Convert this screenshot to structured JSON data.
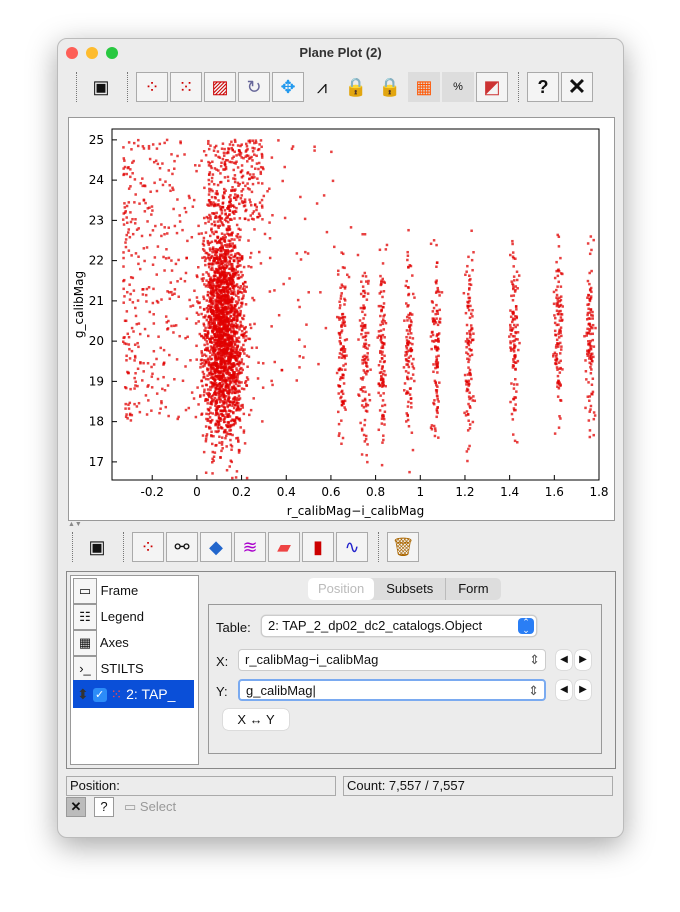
{
  "window": {
    "title": "Plane Plot (2)"
  },
  "toolbar": {
    "icons": [
      "window-icon",
      "plot-lines-icon",
      "subset-blob-icon",
      "subset-rect-icon",
      "replot-icon",
      "navigate-icon",
      "axes-measure-icon",
      "aux-lock-icon",
      "aux-colour-lock-icon",
      "density-icon",
      "sketch-percent-icon",
      "export-icon",
      "help-icon",
      "close-icon"
    ]
  },
  "layer_toolbar": {
    "icons": [
      "float-window-icon",
      "add-position-plot-icon",
      "add-pair-plot-icon",
      "add-area-plot-icon",
      "add-spectrogram-icon",
      "add-fill-plot-icon",
      "add-histogram-icon",
      "add-function-icon",
      "delete-layer-icon"
    ]
  },
  "chart_data": {
    "type": "scatter",
    "title": "",
    "xlabel": "r_calibMag−i_calibMag",
    "ylabel": "g_calibMag",
    "xlim": [
      -0.38,
      1.8
    ],
    "ylim": [
      16.55,
      25.27
    ],
    "xticks": [
      "-0.2",
      "0",
      "0.2",
      "0.4",
      "0.6",
      "0.8",
      "1",
      "1.2",
      "1.4",
      "1.6",
      "1.8"
    ],
    "xtick_values": [
      -0.2,
      0,
      0.2,
      0.4,
      0.6,
      0.8,
      1.0,
      1.2,
      1.4,
      1.6,
      1.8
    ],
    "yticks": [
      "17",
      "18",
      "19",
      "20",
      "21",
      "22",
      "23",
      "24",
      "25"
    ],
    "ytick_values": [
      17,
      18,
      19,
      20,
      21,
      22,
      23,
      24,
      25
    ],
    "grid": false,
    "marker_color": "#e00000",
    "main_locus_x": 0.12,
    "stripe_x": [
      0.65,
      0.75,
      0.83,
      0.95,
      1.07,
      1.22,
      1.42,
      1.62,
      1.76
    ],
    "count": 7557
  },
  "controls": {
    "stack": [
      {
        "label": "Frame",
        "icon": "frame-icon"
      },
      {
        "label": "Legend",
        "icon": "legend-icon"
      },
      {
        "label": "Axes",
        "icon": "axes-icon"
      },
      {
        "label": "STILTS",
        "icon": "stilts-icon"
      }
    ],
    "layer": {
      "label": "2: TAP_",
      "checked": true
    },
    "tabs": [
      "Position",
      "Subsets",
      "Form"
    ],
    "table_label": "Table:",
    "table_value": "2: TAP_2_dp02_dc2_catalogs.Object",
    "x_label": "X:",
    "x_value": "r_calibMag−i_calibMag",
    "y_label": "Y:",
    "y_value": "g_calibMag",
    "swap_label": "X ↔ Y"
  },
  "status": {
    "position": "Position:",
    "count": "Count: 7,557 / 7,557"
  },
  "bottom": {
    "help": "?",
    "select": "Select"
  }
}
